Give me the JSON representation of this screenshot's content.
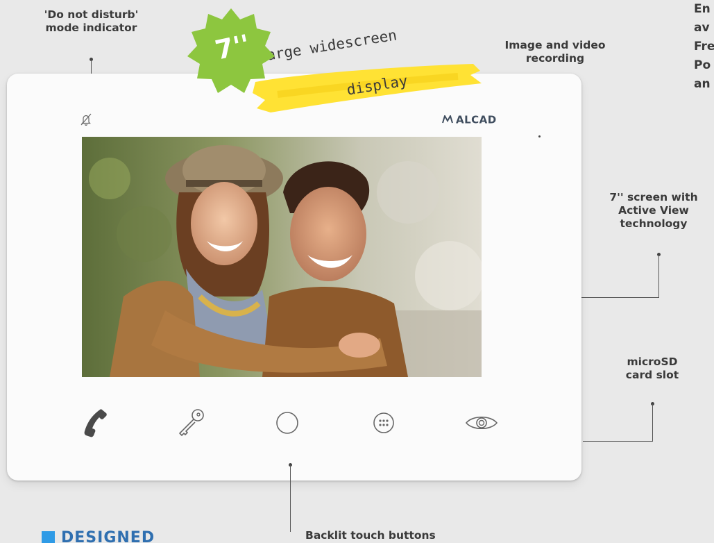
{
  "badge": {
    "size": "7''",
    "tape_line1": "Large widescreen",
    "tape_line2": "display"
  },
  "device": {
    "brand": "ALCAD"
  },
  "callouts": {
    "dnd": {
      "line1": "'Do not disturb'",
      "line2": "mode indicator"
    },
    "recording": {
      "line1": "Image and video",
      "line2": "recording"
    },
    "screen": {
      "line1": "7'' screen with",
      "line2": "Active View",
      "line3": "technology"
    },
    "microsd": {
      "line1": "microSD",
      "line2": "card slot"
    },
    "buttons": {
      "line1": "Backlit touch buttons"
    }
  },
  "right_edge_text": {
    "l1": "En",
    "l2": "av",
    "l3": "Fre",
    "l4": "Po",
    "l5": "an"
  },
  "section": {
    "title": "DESIGNED"
  },
  "colors": {
    "background": "#e9e9e9",
    "device": "#fbfbfb",
    "brand_text": "#3f4d5e",
    "badge_green": "#8dc63f",
    "tape_yellow": "#ffe234",
    "section_blue": "#2f6fb0",
    "section_square": "#2f9be6"
  },
  "icons": {
    "dnd": "bell-off-icon",
    "handset": "phone-handset-icon",
    "key": "key-icon",
    "circle": "circle-button-icon",
    "menu": "grid-menu-icon",
    "eye": "eye-icon"
  }
}
